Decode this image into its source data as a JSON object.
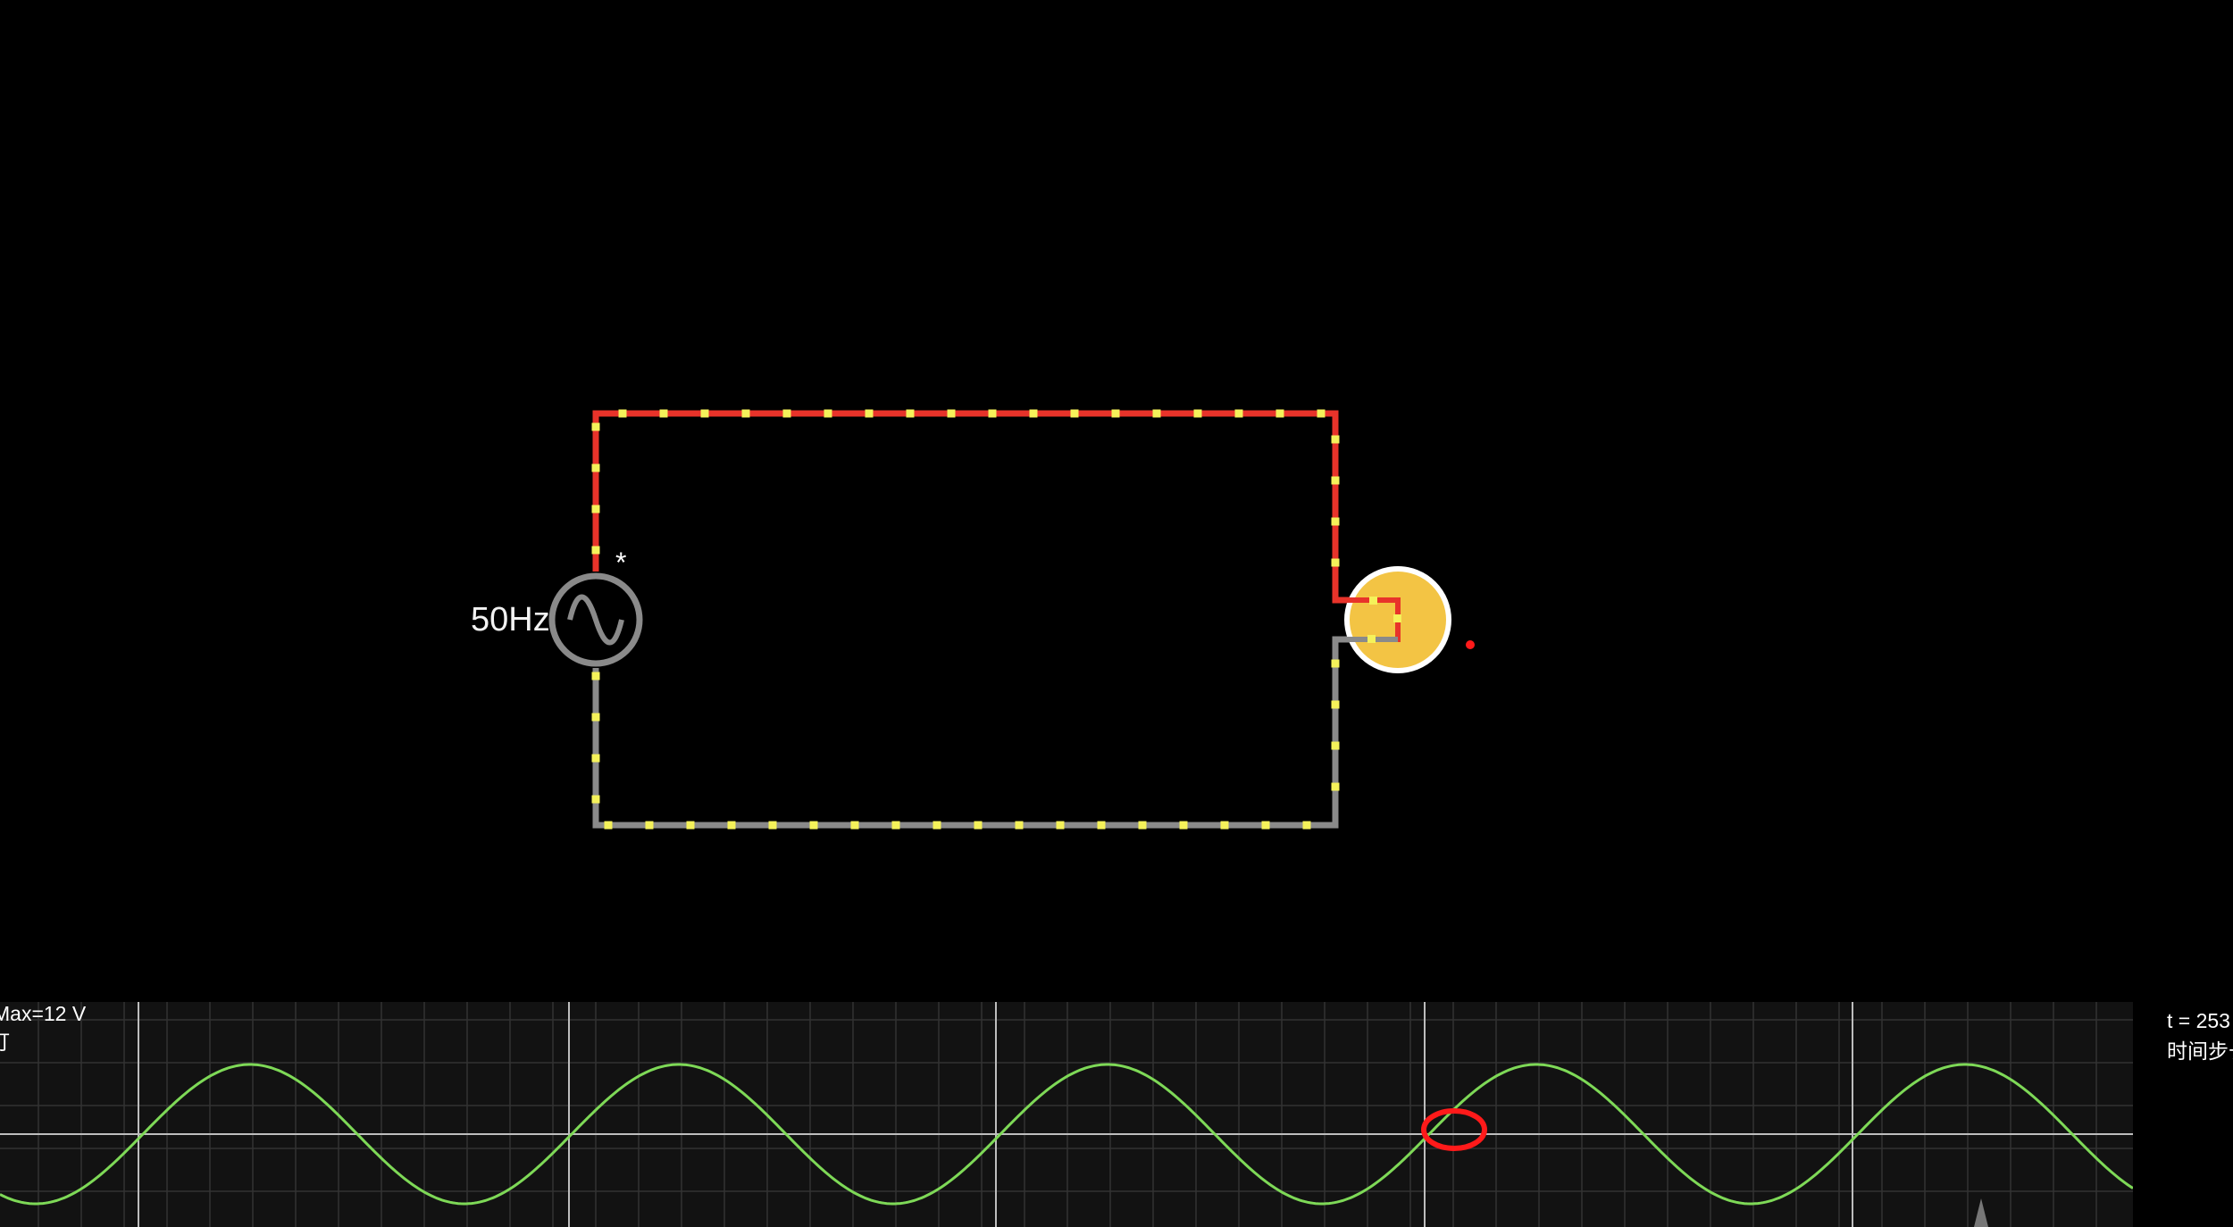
{
  "source": {
    "frequency_label": "50Hz",
    "marker": "*"
  },
  "scope": {
    "max_label": "Max=12 V",
    "sub_label": "灯",
    "time_label": "t = 253",
    "step_label": "时间步长"
  },
  "colors": {
    "background": "#000000",
    "wire_positive": "#e8332a",
    "wire_neutral": "#8a8a8a",
    "current_dot": "#f5f25a",
    "bulb": "#f3c444",
    "bulb_outline": "#ffffff",
    "source_ring": "#8a8a8a",
    "trace": "#7ed957",
    "scope_bg": "#121212",
    "scope_grid": "#3a3a3a",
    "annotation": "#ff1a1a"
  },
  "icons": [
    "ac-source-icon",
    "lamp-icon",
    "annotation-circle-icon"
  ]
}
